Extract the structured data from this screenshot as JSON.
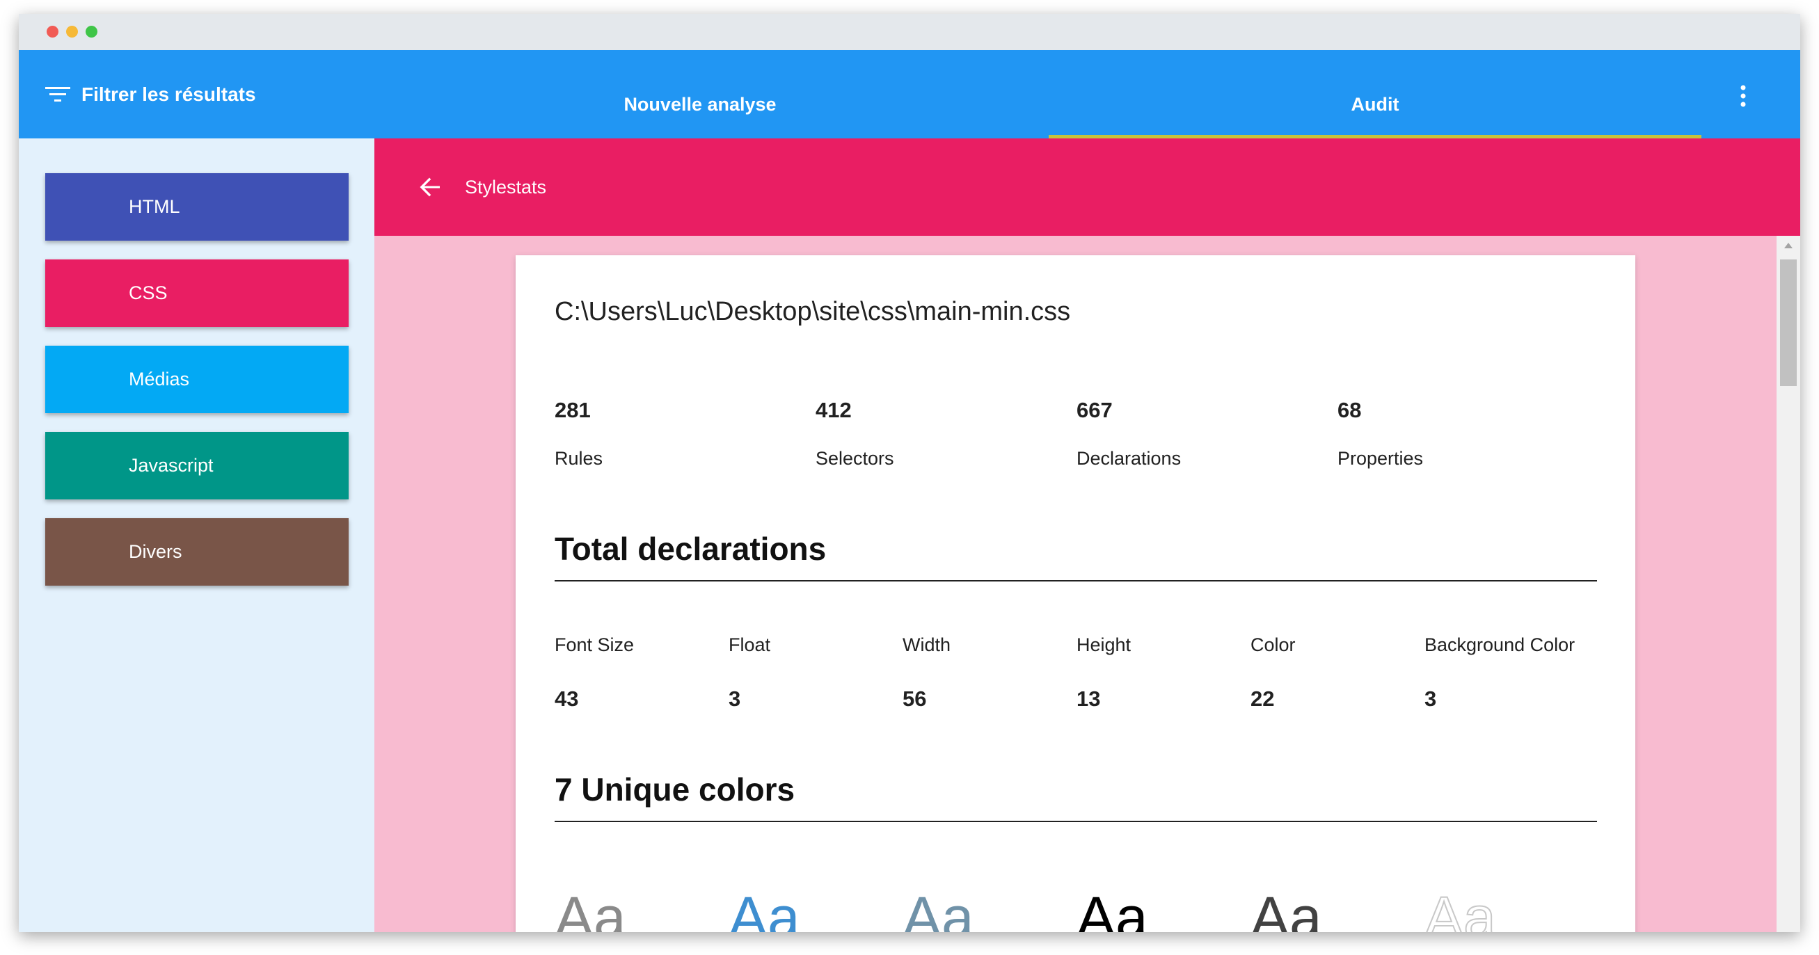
{
  "window": {
    "traffic_lights": [
      "#f15b55",
      "#f6b937",
      "#3fc548"
    ]
  },
  "appbar": {
    "color": "#2196f3",
    "filter_label": "Filtrer les résultats",
    "filter_icon": "filter-list-icon",
    "tabs": [
      {
        "label": "Nouvelle analyse",
        "active": false
      },
      {
        "label": "Audit",
        "active": true
      }
    ],
    "menu_icon": "more-vert-icon"
  },
  "sidebar": {
    "items": [
      {
        "label": "HTML",
        "color": "#3f51b5"
      },
      {
        "label": "CSS",
        "color": "#e91e63"
      },
      {
        "label": "Médias",
        "color": "#03a9f4"
      },
      {
        "label": "Javascript",
        "color": "#009688"
      },
      {
        "label": "Divers",
        "color": "#795548"
      }
    ]
  },
  "toolbar": {
    "color": "#e91e63",
    "back_icon": "arrow-back-icon",
    "title": "Stylestats"
  },
  "report": {
    "file_path": "C:\\Users\\Luc\\Desktop\\site\\css\\main-min.css",
    "stats": [
      {
        "value": "281",
        "label": "Rules"
      },
      {
        "value": "412",
        "label": "Selectors"
      },
      {
        "value": "667",
        "label": "Declarations"
      },
      {
        "value": "68",
        "label": "Properties"
      }
    ],
    "total_declarations": {
      "title": "Total declarations",
      "items": [
        {
          "label": "Font Size",
          "value": "43"
        },
        {
          "label": "Float",
          "value": "3"
        },
        {
          "label": "Width",
          "value": "56"
        },
        {
          "label": "Height",
          "value": "13"
        },
        {
          "label": "Color",
          "value": "22"
        },
        {
          "label": "Background Color",
          "value": "3"
        }
      ]
    },
    "unique_colors": {
      "title": "7 Unique colors",
      "swatches": [
        {
          "text": "Aa",
          "color": "#8a8a8a"
        },
        {
          "text": "Aa",
          "color": "#3e8ed0"
        },
        {
          "text": "Aa",
          "color": "#7092a8"
        },
        {
          "text": "Aa",
          "color": "#000000"
        },
        {
          "text": "Aa",
          "color": "#424242"
        },
        {
          "text": "Aa",
          "color": "#ffffff"
        }
      ]
    }
  }
}
